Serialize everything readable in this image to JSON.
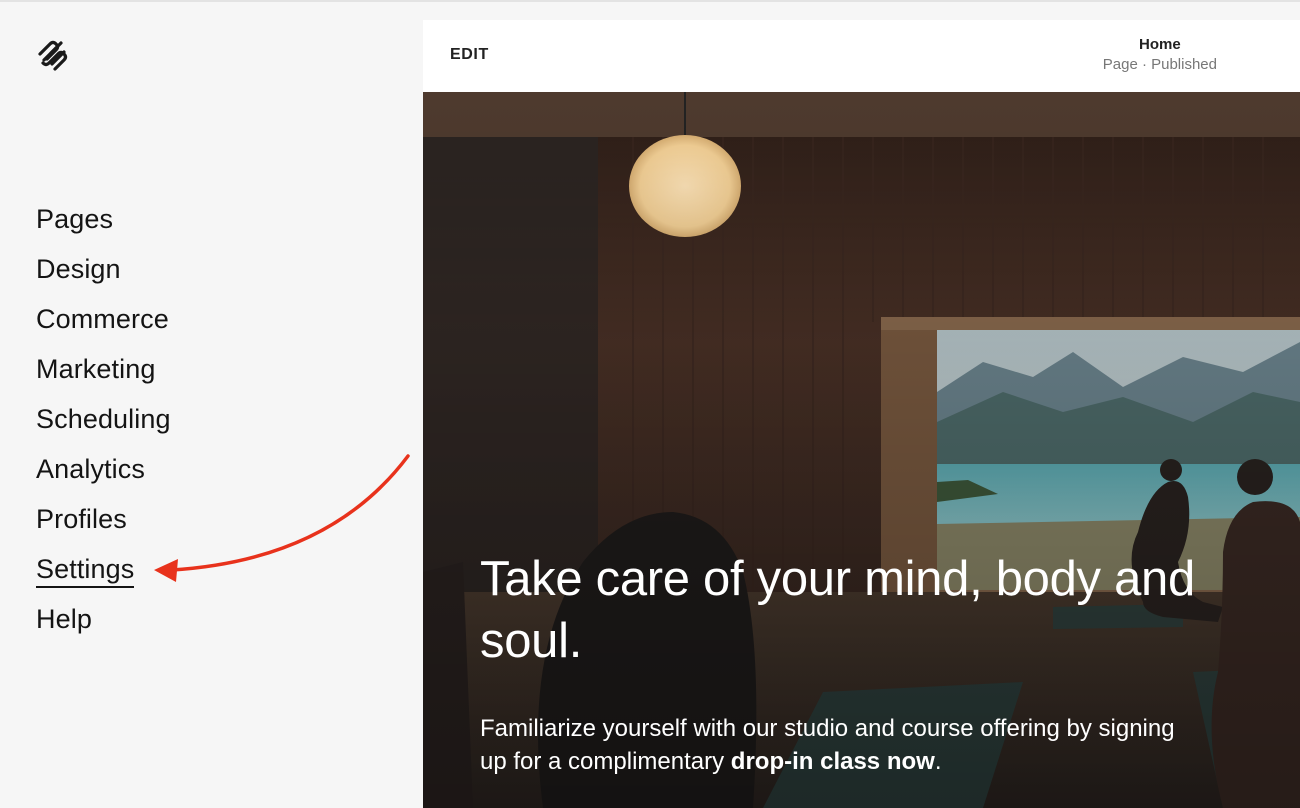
{
  "sidebar": {
    "logo": "squarespace-logo-icon",
    "nav": [
      {
        "label": "Pages"
      },
      {
        "label": "Design"
      },
      {
        "label": "Commerce"
      },
      {
        "label": "Marketing"
      },
      {
        "label": "Scheduling"
      },
      {
        "label": "Analytics"
      },
      {
        "label": "Profiles"
      },
      {
        "label": "Settings",
        "active": true
      },
      {
        "label": "Help"
      }
    ],
    "annotation": {
      "icon": "red-arrow-icon",
      "points_to": "Settings",
      "color": "#e8321c"
    }
  },
  "preview": {
    "edit_label": "EDIT",
    "page_title": "Home",
    "page_status": "Page · Published",
    "hero": {
      "headline": "Take care of your mind, body and soul.",
      "body_text": "Familiarize yourself with our studio and course offering by signing up for a complimentary ",
      "body_link": "drop-in class now",
      "body_end": "."
    }
  },
  "colors": {
    "sidebar_bg": "#f6f6f6",
    "text": "#141414",
    "arrow": "#e8321c",
    "hero_overlay": "#3a2820"
  }
}
